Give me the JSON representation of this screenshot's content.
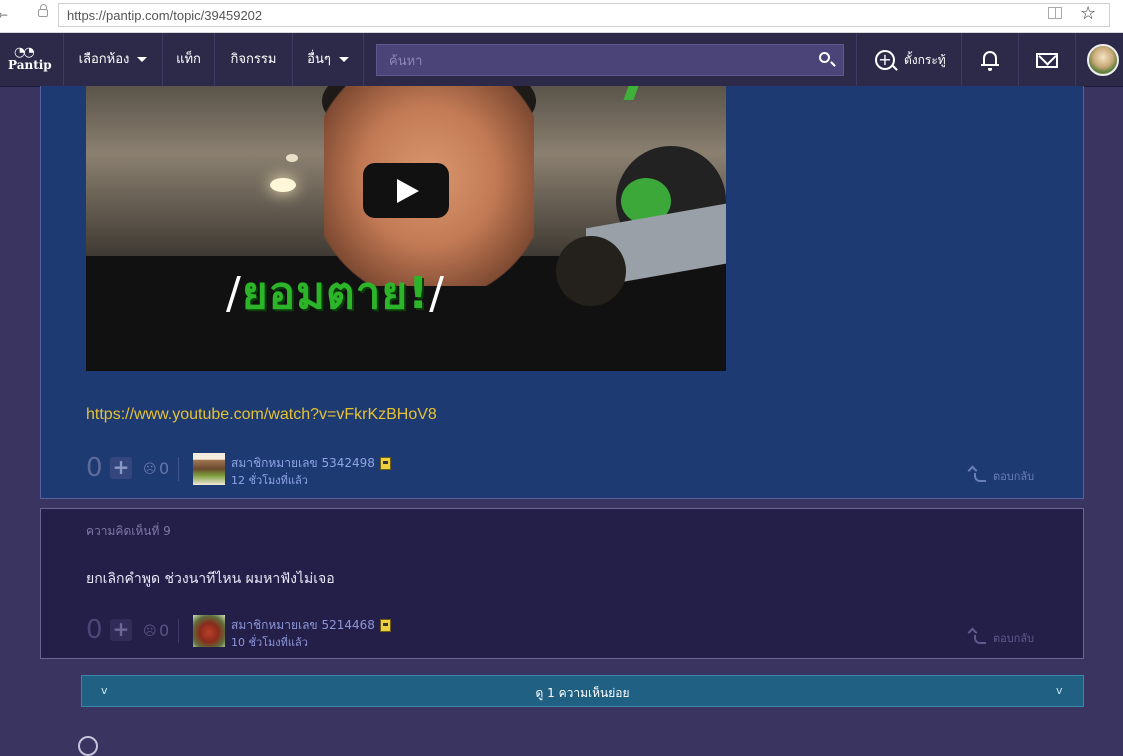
{
  "browser": {
    "url": "https://pantip.com/topic/39459202"
  },
  "nav": {
    "logo_text": "Pantip",
    "rooms_label": "เลือกห้อง",
    "tags_label": "แท็ก",
    "activities_label": "กิจกรรม",
    "more_label": "อื่นๆ",
    "search_placeholder": "ค้นหา",
    "new_topic_label": "ตั้งกระทู้"
  },
  "comment1": {
    "video_headline": "ยอมตาย!",
    "link": "https://www.youtube.com/watch?v=vFkrKzBHoV8",
    "vote_count": "0",
    "emotion_count": "0",
    "member": "สมาชิกหมายเลข 5342498",
    "time": "12 ชั่วโมงที่แล้ว",
    "reply_label": "ตอบกลับ"
  },
  "comment2": {
    "label": "ความคิดเห็นที่ 9",
    "text": "ยกเลิกคำพูด ช่วงนาทีไหน ผมหาฟังไม่เจอ",
    "vote_count": "0",
    "emotion_count": "0",
    "member": "สมาชิกหมายเลข 5214468",
    "time": "10 ชั่วโมงที่แล้ว",
    "reply_label": "ตอบกลับ"
  },
  "expand": {
    "label": "ดู 1 ความเห็นย่อย",
    "chevron": "v"
  },
  "colors": {
    "nav_bg": "#2d2a49",
    "comment_highlight_bg": "#1e3a72",
    "comment_bg": "#241f48",
    "link": "#e5c233",
    "expand_bar": "#1f6083"
  }
}
